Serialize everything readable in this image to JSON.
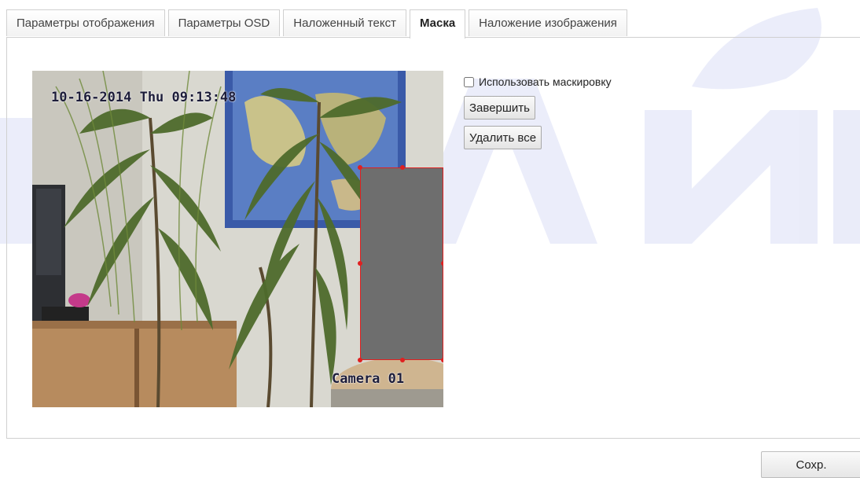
{
  "tabs": [
    {
      "label": "Параметры отображения",
      "active": false
    },
    {
      "label": "Параметры OSD",
      "active": false
    },
    {
      "label": "Наложенный текст",
      "active": false
    },
    {
      "label": "Маска",
      "active": true
    },
    {
      "label": "Наложение изображения",
      "active": false
    }
  ],
  "video": {
    "osd_datetime": "10-16-2014 Thu 09:13:48",
    "osd_camera_name": "Camera 01"
  },
  "mask": {
    "enable_label": "Использовать маскировку",
    "enable_checked": false,
    "finish_button": "Завершить",
    "delete_all_button": "Удалить все",
    "region_color": "#6e6e6e",
    "region_border_color": "#e02020"
  },
  "footer": {
    "save_button": "Сохр."
  },
  "colors": {
    "watermark": "#5b6bd6",
    "tab_border": "#d0d0d0"
  }
}
